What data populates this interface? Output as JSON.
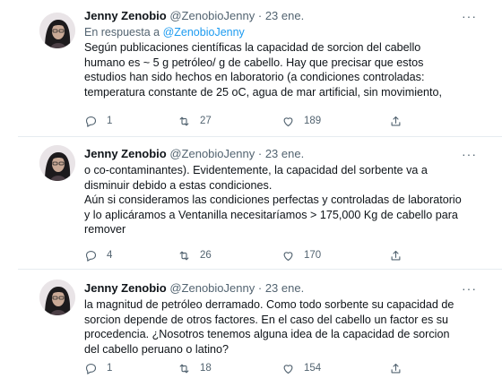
{
  "tweets": [
    {
      "author_name": "Jenny Zenobio",
      "handle": "@ZenobioJenny",
      "separator": "·",
      "date": "23 ene.",
      "more": "···",
      "reply_to_prefix": "En respuesta a",
      "reply_to_handle": "@ZenobioJenny",
      "text": "Según publicaciones científicas la capacidad de sorcion del cabello\nhumano es ~ 5 g petróleo/ g de cabello. Hay que precisar que estos\nestudios han sido hechos en laboratorio (a condiciones controladas:\ntemperatura constante de 25 oC, agua de mar artificial, sin movimiento,",
      "replies": "1",
      "retweets": "27",
      "likes": "189"
    },
    {
      "author_name": "Jenny Zenobio",
      "handle": "@ZenobioJenny",
      "separator": "·",
      "date": "23 ene.",
      "more": "···",
      "text": "o co-contaminantes). Evidentemente, la capacidad del sorbente va a\ndisminuir debido a estas condiciones.\nAún si consideramos las condiciones perfectas y controladas de laboratorio\ny lo aplicáramos a Ventanilla necesitaríamos > 175,000 Kg de cabello para\nremover",
      "replies": "4",
      "retweets": "26",
      "likes": "170"
    },
    {
      "author_name": "Jenny Zenobio",
      "handle": "@ZenobioJenny",
      "separator": "·",
      "date": "23 ene.",
      "more": "···",
      "text": "la magnitud de petróleo derramado. Como todo sorbente su capacidad de\nsorcion depende de otros factores. En el caso del cabello un factor es su\nprocedencia. ¿Nosotros tenemos alguna idea de la capacidad de sorcion\ndel cabello peruano o latino?",
      "replies": "1",
      "retweets": "18",
      "likes": "154"
    }
  ],
  "icons": {
    "reply": "reply-icon",
    "retweet": "retweet-icon",
    "like": "heart-icon",
    "share": "share-icon",
    "more": "more-options-icon"
  },
  "colors": {
    "text": "#0f1419",
    "secondary": "#536471",
    "link": "#1d9bf0",
    "divider": "#e6ecf0"
  }
}
